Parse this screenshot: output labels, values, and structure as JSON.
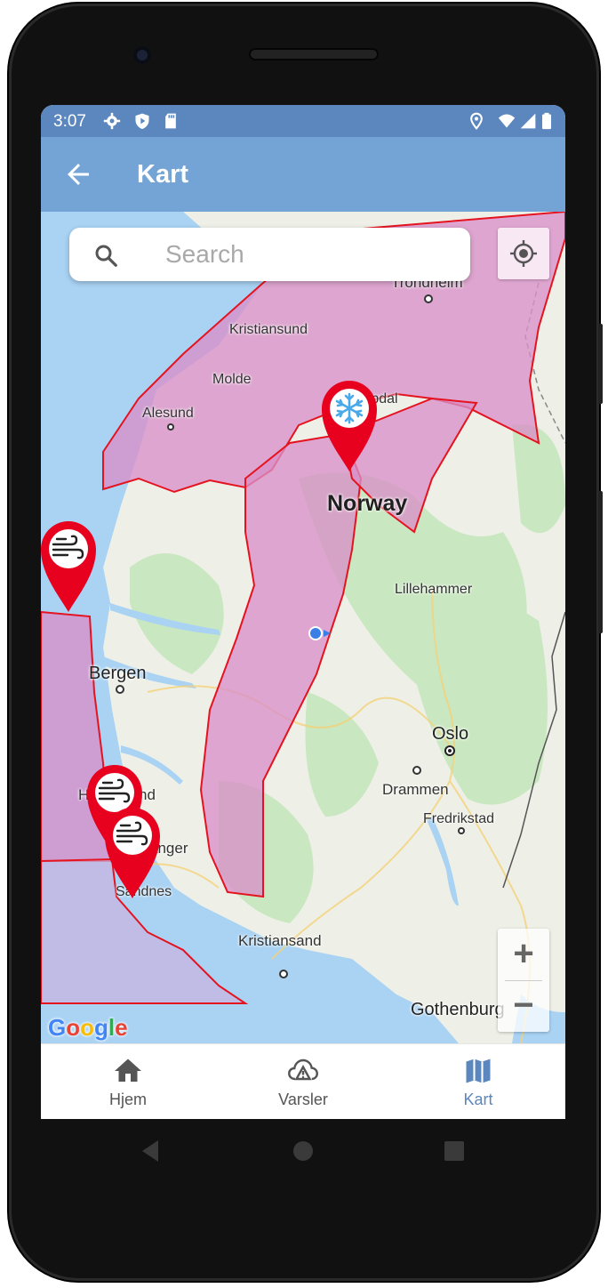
{
  "status": {
    "time": "3:07",
    "left_icons": [
      "gear-icon",
      "shield-play-icon",
      "sd-card-icon"
    ],
    "right_icons": [
      "location-icon",
      "wifi-icon",
      "signal-icon",
      "battery-icon"
    ]
  },
  "appbar": {
    "title": "Kart",
    "back_icon": "arrow-left-icon"
  },
  "search": {
    "placeholder": "Search",
    "value": ""
  },
  "map": {
    "labels": {
      "trondheim": "Trondheim",
      "kristiansund": "Kristiansund",
      "molde": "Molde",
      "alesund": "Alesund",
      "oppdal": "Oppdal",
      "norway": "Norway",
      "lillehammer": "Lillehammer",
      "bergen": "Bergen",
      "oslo": "Oslo",
      "drammen": "Drammen",
      "fredrikstad": "Fredrikstad",
      "haugesund": "Haugesund",
      "stavanger": "Stavanger",
      "sandnes": "Sandnes",
      "kristiansand": "Kristiansand",
      "gothenburg": "Gothenburg"
    },
    "attribution": [
      "G",
      "o",
      "o",
      "g",
      "l",
      "e"
    ],
    "attribution_colors": [
      "#4285F4",
      "#EA4335",
      "#FBBC05",
      "#4285F4",
      "#34A853",
      "#EA4335"
    ],
    "warning_markers": [
      "snowflake-icon",
      "wind-icon",
      "wind-icon",
      "wind-icon"
    ],
    "zoom_in": "+",
    "zoom_out": "−",
    "colors": {
      "warning_fill": "#d98fc8",
      "warning_stroke": "#e5131f",
      "marker": "#e8001f",
      "water": "#a9d2f3"
    }
  },
  "bottom_nav": [
    {
      "label": "Hjem",
      "icon": "home-icon",
      "active": false
    },
    {
      "label": "Varsler",
      "icon": "cloud-warning-icon",
      "active": false
    },
    {
      "label": "Kart",
      "icon": "map-icon",
      "active": true
    }
  ],
  "system_nav": [
    "back-triangle-icon",
    "home-circle-icon",
    "recents-square-icon"
  ]
}
